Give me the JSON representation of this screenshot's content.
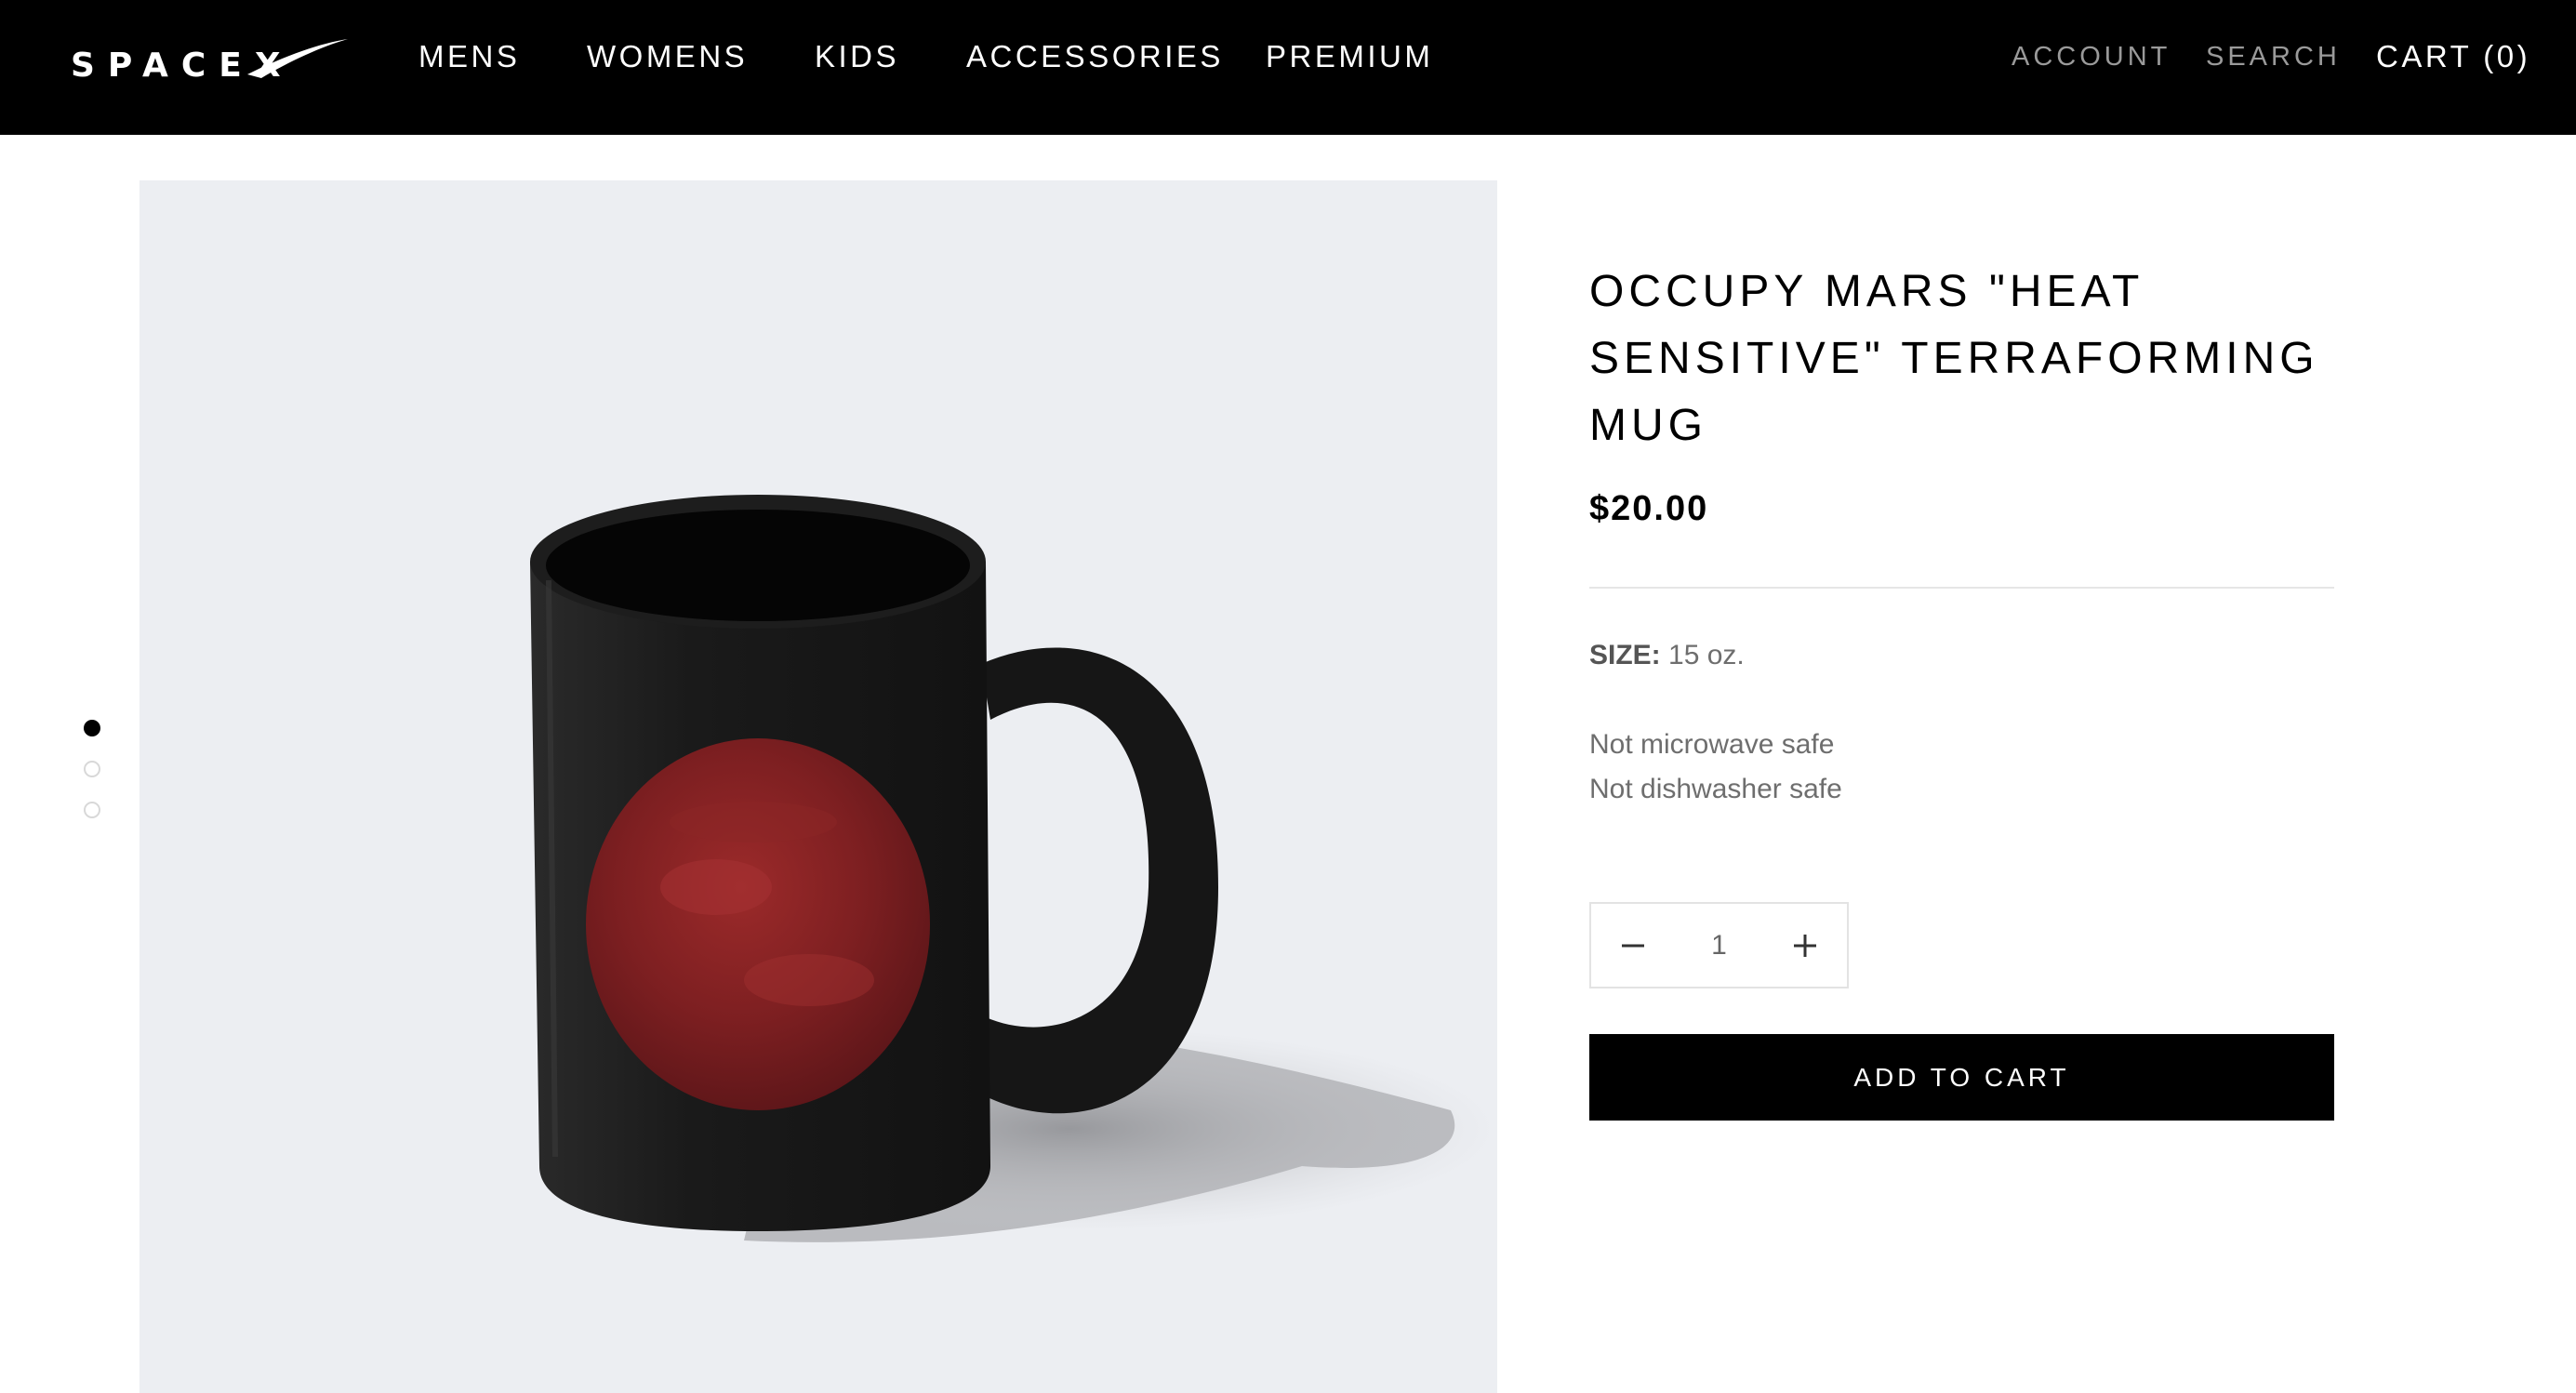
{
  "header": {
    "logo_text": "SPACEX",
    "nav": [
      "MENS",
      "WOMENS",
      "KIDS",
      "ACCESSORIES",
      "PREMIUM"
    ],
    "account_label": "ACCOUNT",
    "search_label": "SEARCH",
    "cart_label": "CART (0)"
  },
  "gallery": {
    "slide_count": 3,
    "active_slide": 1
  },
  "product": {
    "title": "OCCUPY MARS \"HEAT SENSITIVE\" TERRAFORMING MUG",
    "price": "$20.00",
    "size_label": "SIZE:",
    "size_value": "15 oz.",
    "notes": [
      "Not microwave safe",
      "Not dishwasher safe"
    ],
    "quantity": "1",
    "add_to_cart_label": "ADD TO CART"
  },
  "icons": {
    "minus": "minus-icon",
    "plus": "plus-icon"
  },
  "colors": {
    "header_bg": "#000000",
    "image_bg": "#eceef2",
    "mars": "#7a1e1e",
    "mug": "#1b1b1b"
  }
}
